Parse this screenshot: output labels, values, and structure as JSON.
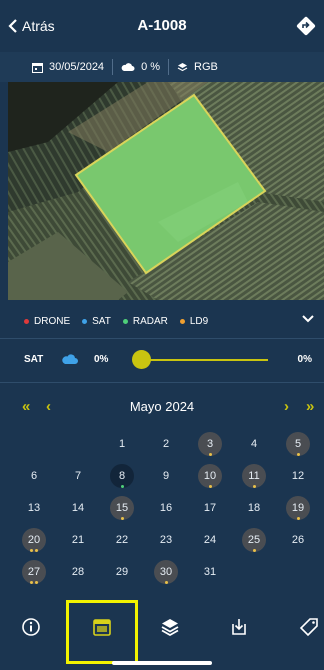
{
  "header": {
    "back_label": "Atrás",
    "title": "A-1008",
    "nav_icon": "directions-icon"
  },
  "info": {
    "date": "30/05/2024",
    "cloud": "0 %",
    "band": "RGB"
  },
  "legend": [
    {
      "label": "DRONE",
      "color": "#e03a3a"
    },
    {
      "label": "SAT",
      "color": "#3fa2e8"
    },
    {
      "label": "RADAR",
      "color": "#4fd07a"
    },
    {
      "label": "LD9",
      "color": "#f0a030"
    }
  ],
  "slider": {
    "source": "SAT",
    "left_value": "0%",
    "right_value": "0%",
    "cloud_color": "#3fa2e8",
    "accent": "#c9c410",
    "level_fraction": 0
  },
  "calendar": {
    "month": "Mayo 2024",
    "prev_year": "«",
    "prev_month": "‹",
    "next_month": "›",
    "next_year": "»",
    "days": [
      {
        "d": "1",
        "hl": false,
        "dots": []
      },
      {
        "d": "2",
        "hl": false,
        "dots": []
      },
      {
        "d": "3",
        "hl": true,
        "dots": [
          "#e8c04a"
        ]
      },
      {
        "d": "4",
        "hl": false,
        "dots": []
      },
      {
        "d": "5",
        "hl": true,
        "dots": [
          "#e8c04a"
        ]
      },
      {
        "d": "6",
        "hl": false,
        "dots": []
      },
      {
        "d": "7",
        "hl": false,
        "dots": []
      },
      {
        "d": "8",
        "hl": false,
        "today": true,
        "dots": [
          "#4fd07a"
        ]
      },
      {
        "d": "9",
        "hl": false,
        "dots": []
      },
      {
        "d": "10",
        "hl": true,
        "dots": [
          "#e8c04a"
        ]
      },
      {
        "d": "11",
        "hl": true,
        "dots": [
          "#e8c04a"
        ]
      },
      {
        "d": "12",
        "hl": false,
        "dots": []
      },
      {
        "d": "13",
        "hl": false,
        "dots": []
      },
      {
        "d": "14",
        "hl": false,
        "dots": []
      },
      {
        "d": "15",
        "hl": true,
        "dots": [
          "#e8c04a"
        ]
      },
      {
        "d": "16",
        "hl": false,
        "dots": []
      },
      {
        "d": "17",
        "hl": false,
        "dots": []
      },
      {
        "d": "18",
        "hl": false,
        "dots": []
      },
      {
        "d": "19",
        "hl": true,
        "dots": [
          "#e8c04a"
        ]
      },
      {
        "d": "20",
        "hl": true,
        "dots": [
          "#e8c04a",
          "#e8c04a"
        ]
      },
      {
        "d": "21",
        "hl": false,
        "dots": []
      },
      {
        "d": "22",
        "hl": false,
        "dots": []
      },
      {
        "d": "23",
        "hl": false,
        "dots": []
      },
      {
        "d": "24",
        "hl": false,
        "dots": []
      },
      {
        "d": "25",
        "hl": true,
        "dots": [
          "#e8c04a"
        ]
      },
      {
        "d": "26",
        "hl": false,
        "dots": []
      },
      {
        "d": "27",
        "hl": true,
        "dots": [
          "#e8c04a",
          "#e8c04a"
        ]
      },
      {
        "d": "28",
        "hl": false,
        "dots": []
      },
      {
        "d": "29",
        "hl": false,
        "dots": []
      },
      {
        "d": "30",
        "hl": true,
        "dots": [
          "#e8c04a"
        ]
      },
      {
        "d": "31",
        "hl": false,
        "dots": []
      }
    ]
  },
  "tabs": [
    {
      "name": "tab-info",
      "icon": "info-icon"
    },
    {
      "name": "tab-calendar",
      "icon": "calendar-icon",
      "active": true
    },
    {
      "name": "tab-layers",
      "icon": "layers-icon"
    },
    {
      "name": "tab-download",
      "icon": "download-icon"
    },
    {
      "name": "tab-tag",
      "icon": "tag-icon"
    }
  ]
}
